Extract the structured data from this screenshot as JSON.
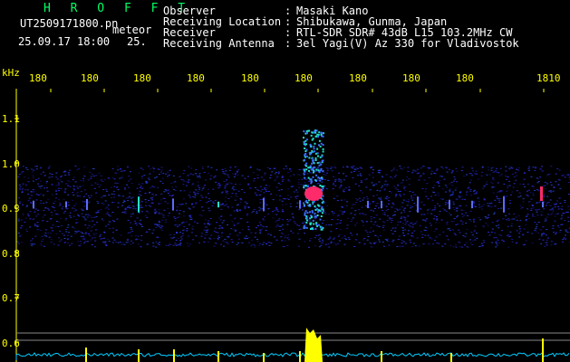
{
  "header": {
    "brand": "H R O F F T",
    "filename": "UT2509171800.pn",
    "tag": "meteor",
    "timestamp": "25.09.17 18:00",
    "counter": "25.",
    "fields": [
      {
        "label": "Observer",
        "value": "Masaki Kano"
      },
      {
        "label": "Receiving Location",
        "value": "Shibukawa, Gunma, Japan"
      },
      {
        "label": "Receiver",
        "value": "RTL-SDR SDR# 43dB L15 103.2MHz CW"
      },
      {
        "label": "Receiving Antenna",
        "value": "3el Yagi(V) Az 330 for Vladivostok"
      }
    ]
  },
  "axis": {
    "unit": "kHz",
    "top_ticks": [
      "180",
      "180",
      "180",
      "180",
      "180",
      "180",
      "180",
      "180",
      "180",
      "1810"
    ],
    "left_ticks": [
      "1.1",
      "1.0",
      "0.9",
      "0.8",
      "0.7",
      "0.6"
    ]
  },
  "colors": {
    "background": "#000000",
    "noise": "#1a1aa0",
    "meteor_core": "#ff2a6a",
    "meteor_mid": "#22e0c8",
    "level_trace": "#00ccff",
    "spike": "#ffff00",
    "text_header": "#ffffff",
    "text_axis": "#ffff00",
    "brand": "#00ff66"
  }
}
